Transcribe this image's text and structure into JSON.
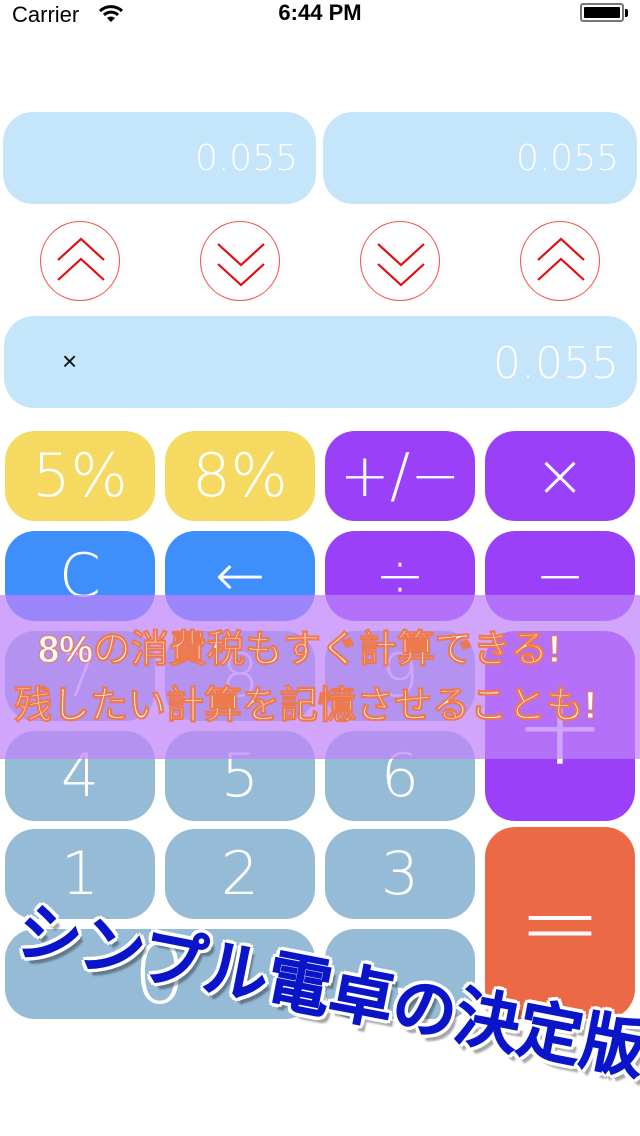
{
  "status_bar": {
    "carrier": "Carrier",
    "time": "6:44 PM",
    "wifi_icon": "wifi-icon",
    "battery_icon": "battery-icon",
    "battery_level": 1.0
  },
  "memory_displays": [
    {
      "name": "left-memory",
      "value": "0.055"
    },
    {
      "name": "right-memory",
      "value": "0.055"
    }
  ],
  "arrow_buttons": [
    {
      "name": "store-left-up",
      "icon": "double-chevron-up-icon"
    },
    {
      "name": "recall-left-down",
      "icon": "double-chevron-down-icon"
    },
    {
      "name": "recall-right-down",
      "icon": "double-chevron-down-icon"
    },
    {
      "name": "store-right-up",
      "icon": "double-chevron-up-icon"
    }
  ],
  "main_display": {
    "operator": "×",
    "value": "0.055"
  },
  "keypad": {
    "tax5": "5%",
    "tax8": "8%",
    "sign": "+/−",
    "multiply": "×",
    "clear": "C",
    "backspace": "←",
    "divide": "÷",
    "minus": "−",
    "seven": "7",
    "eight": "8",
    "nine": "9",
    "plus": "+",
    "four": "4",
    "five": "5",
    "six": "6",
    "one": "1",
    "two": "2",
    "three": "3",
    "equals": "=",
    "zero": "0",
    "decimal": "."
  },
  "colors": {
    "display_bg": "#c4e5fa",
    "tax_key": "#f6d960",
    "operator_key": "#9a40f8",
    "clear_key": "#3e8ffb",
    "digit_key": "#96bbd7",
    "equals_key": "#eb6944",
    "arrow": "#e01010",
    "promo_band": "#c88af8",
    "headline": "#0a14c8"
  },
  "promo": {
    "line1": "8%の消費税もすぐ計算できる!",
    "line2": "残したい計算を記憶させることも!",
    "headline": "シンプル電卓の決定版!!"
  }
}
